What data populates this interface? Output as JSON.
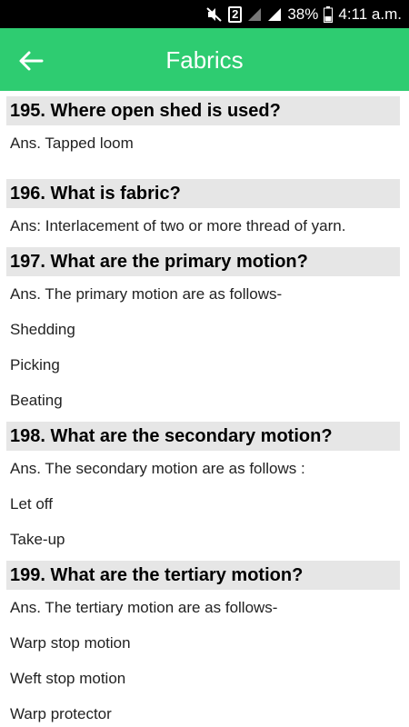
{
  "status_bar": {
    "mute_icon": "mute-icon",
    "sim_label": "2",
    "battery": "38%",
    "time": "4:11 a.m."
  },
  "app_bar": {
    "title": "Fabrics",
    "back_icon": "arrow-left-icon"
  },
  "colors": {
    "accent": "#2ecc71",
    "question_bg": "#e6e6e6"
  },
  "questions": [
    {
      "q": "195. Where open shed is used?",
      "answers": [
        "Ans. Tapped loom"
      ]
    },
    {
      "q": "196. What is fabric?",
      "answers": [
        "Ans: Interlacement of two or more thread of yarn."
      ]
    },
    {
      "q": "197. What are the primary motion?",
      "answers": [
        "Ans. The primary motion are as follows-",
        "Shedding",
        "Picking",
        "Beating"
      ]
    },
    {
      "q": "198. What are the secondary motion?",
      "answers": [
        "Ans. The secondary motion are as follows :",
        "Let off",
        "Take-up"
      ]
    },
    {
      "q": "199. What are the tertiary motion?",
      "answers": [
        "Ans. The tertiary motion are as follows-",
        "Warp stop motion",
        "Weft stop motion",
        "Warp protector"
      ]
    }
  ]
}
